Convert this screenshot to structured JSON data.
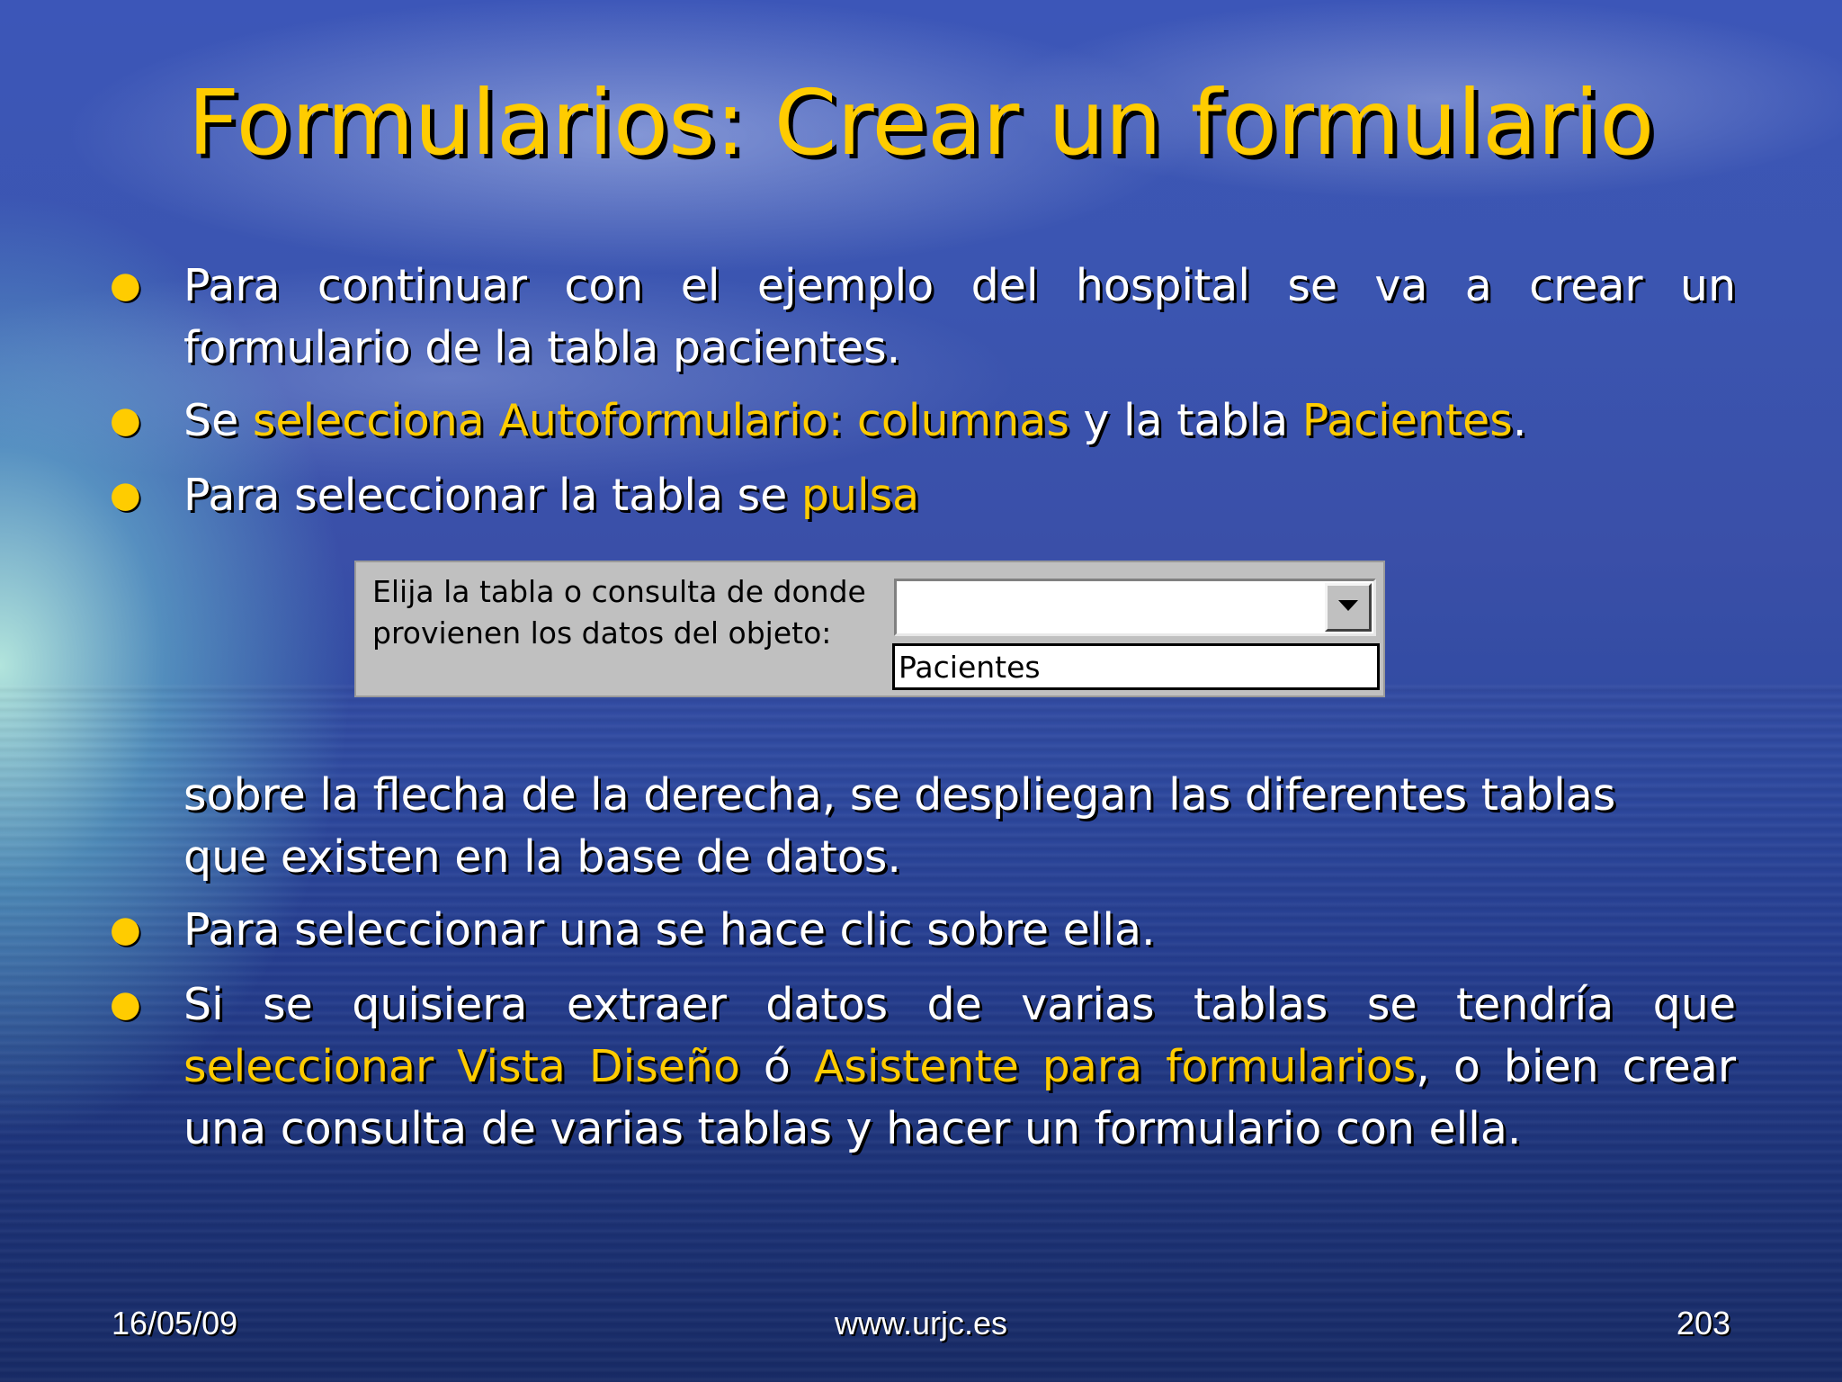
{
  "title": "Formularios: Crear un formulario",
  "bullets": [
    {
      "just_lines": [
        "Para continuar con el ejemplo del hospital se va a crear un"
      ],
      "last_line": "formulario de la tabla pacientes."
    },
    {
      "parts": [
        "Se ",
        "selecciona Autoformulario: columnas",
        " y la tabla ",
        "Pacientes",
        "."
      ]
    },
    {
      "parts": [
        "Para seleccionar la tabla se ",
        "pulsa"
      ]
    }
  ],
  "dialog": {
    "label": "Elija la tabla o consulta de donde provienen los datos del objeto:",
    "combo_value": "",
    "list_item": "Pacientes"
  },
  "continuation": {
    "just_line": "sobre la flecha de la derecha, se despliegan las diferentes tablas",
    "last_line": "que existen en la base de datos."
  },
  "bullets_after": [
    {
      "text": "Para seleccionar una se hace clic sobre ella."
    },
    {
      "line1": "Si se quisiera extraer datos de varias tablas se tendría que",
      "line2_parts": [
        "seleccionar Vista Diseño",
        " ó ",
        "Asistente para formularios",
        ", o bien crear"
      ],
      "line3": "una consulta de varias tablas y hacer un formulario con ella."
    }
  ],
  "footer": {
    "date": "16/05/09",
    "url": "www.urjc.es",
    "page": "203"
  },
  "colors": {
    "highlight": "#ffcc00",
    "text": "#ffffff"
  }
}
